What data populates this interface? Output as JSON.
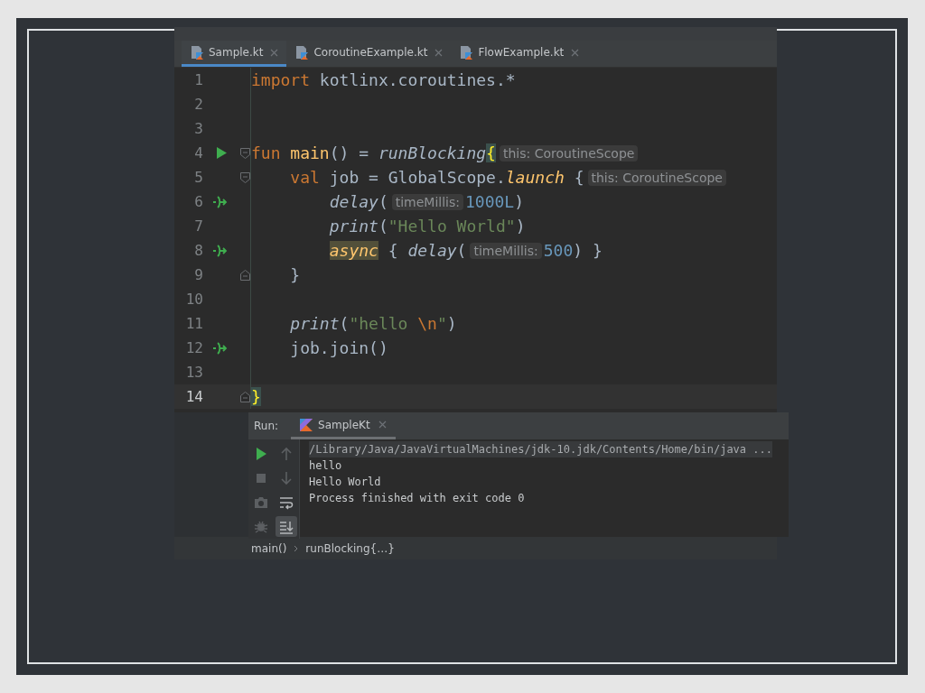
{
  "tabs": [
    {
      "label": "Sample.kt",
      "selected": true
    },
    {
      "label": "CoroutineExample.kt",
      "selected": false
    },
    {
      "label": "FlowExample.kt",
      "selected": false
    }
  ],
  "editor": {
    "lines": [
      {
        "number": "1",
        "current": false,
        "run_marker": false,
        "suspend_marker": false,
        "fold_start": false,
        "fold_end": false,
        "tokens": [
          {
            "t": "import",
            "kind": "keyword"
          },
          {
            "t": " kotlinx.coroutines.*",
            "kind": "plain"
          }
        ]
      },
      {
        "number": "2",
        "current": false,
        "run_marker": false,
        "suspend_marker": false,
        "fold_start": false,
        "fold_end": false
      },
      {
        "number": "3",
        "current": false,
        "run_marker": false,
        "suspend_marker": false,
        "fold_start": false,
        "fold_end": false
      },
      {
        "number": "4",
        "current": false,
        "run_marker": true,
        "suspend_marker": false,
        "fold_start": true,
        "fold_end": false,
        "tokens": [
          {
            "t": "fun",
            "kind": "keyword"
          },
          {
            "t": " main",
            "kind": "name"
          },
          {
            "t": "() = ",
            "kind": "plain"
          },
          {
            "t": "runBlocking",
            "kind": "call"
          },
          {
            "t": "{",
            "kind": "brace-match"
          },
          {
            "t": "this: CoroutineScope",
            "kind": "hint"
          }
        ]
      },
      {
        "number": "5",
        "current": false,
        "run_marker": false,
        "suspend_marker": false,
        "fold_start": true,
        "fold_end": false,
        "tokens": [
          {
            "t": "    val",
            "kind": "keyword"
          },
          {
            "t": " job = GlobalScope.",
            "kind": "plain"
          },
          {
            "t": "launch",
            "kind": "ext-call"
          },
          {
            "t": " {",
            "kind": "plain"
          },
          {
            "t": "this: CoroutineScope",
            "kind": "hint"
          }
        ]
      },
      {
        "number": "6",
        "current": false,
        "run_marker": false,
        "suspend_marker": true,
        "fold_start": false,
        "fold_end": false,
        "tokens": [
          {
            "t": "        delay",
            "kind": "call"
          },
          {
            "t": "(",
            "kind": "plain"
          },
          {
            "t": "timeMillis:",
            "kind": "hint"
          },
          {
            "t": "1000L",
            "kind": "number"
          },
          {
            "t": ")",
            "kind": "plain"
          }
        ]
      },
      {
        "number": "7",
        "current": false,
        "run_marker": false,
        "suspend_marker": false,
        "fold_start": false,
        "fold_end": false,
        "tokens": [
          {
            "t": "        print",
            "kind": "call"
          },
          {
            "t": "(",
            "kind": "plain"
          },
          {
            "t": "\"Hello World\"",
            "kind": "string"
          },
          {
            "t": ")",
            "kind": "plain"
          }
        ]
      },
      {
        "number": "8",
        "current": false,
        "run_marker": false,
        "suspend_marker": true,
        "fold_start": false,
        "fold_end": false,
        "tokens": [
          {
            "t": "        async",
            "kind": "async-highlight"
          },
          {
            "t": " { ",
            "kind": "plain"
          },
          {
            "t": "delay",
            "kind": "call"
          },
          {
            "t": "(",
            "kind": "plain"
          },
          {
            "t": "timeMillis:",
            "kind": "hint"
          },
          {
            "t": "500",
            "kind": "number"
          },
          {
            "t": ") }",
            "kind": "plain"
          }
        ]
      },
      {
        "number": "9",
        "current": false,
        "run_marker": false,
        "suspend_marker": false,
        "fold_start": false,
        "fold_end": true,
        "tokens": [
          {
            "t": "    }",
            "kind": "plain"
          }
        ]
      },
      {
        "number": "10",
        "current": false,
        "run_marker": false,
        "suspend_marker": false,
        "fold_start": false,
        "fold_end": false
      },
      {
        "number": "11",
        "current": false,
        "run_marker": false,
        "suspend_marker": false,
        "fold_start": false,
        "fold_end": false,
        "tokens": [
          {
            "t": "    print",
            "kind": "call"
          },
          {
            "t": "(",
            "kind": "plain"
          },
          {
            "t": "\"hello ",
            "kind": "string"
          },
          {
            "t": "\\n",
            "kind": "escape"
          },
          {
            "t": "\"",
            "kind": "string"
          },
          {
            "t": ")",
            "kind": "plain"
          }
        ]
      },
      {
        "number": "12",
        "current": false,
        "run_marker": false,
        "suspend_marker": true,
        "fold_start": false,
        "fold_end": false,
        "tokens": [
          {
            "t": "    job.join()",
            "kind": "plain"
          }
        ]
      },
      {
        "number": "13",
        "current": false,
        "run_marker": false,
        "suspend_marker": false,
        "fold_start": false,
        "fold_end": false
      },
      {
        "number": "14",
        "current": true,
        "run_marker": false,
        "suspend_marker": false,
        "fold_start": false,
        "fold_end": true,
        "tokens": [
          {
            "t": "}",
            "kind": "brace-match"
          }
        ]
      }
    ]
  },
  "run_panel": {
    "label": "Run:",
    "tab": "SampleKt",
    "tools": [
      {
        "kind": "run",
        "disabled": false,
        "selected": false
      },
      {
        "kind": "up",
        "disabled": true,
        "selected": false
      },
      {
        "kind": "stop",
        "disabled": true,
        "selected": false
      },
      {
        "kind": "down",
        "disabled": true,
        "selected": false
      },
      {
        "kind": "camera",
        "disabled": true,
        "selected": false
      },
      {
        "kind": "wrap",
        "disabled": false,
        "selected": false
      },
      {
        "kind": "bug",
        "disabled": true,
        "selected": false
      },
      {
        "kind": "scroll-end",
        "disabled": false,
        "selected": true
      }
    ],
    "output": [
      {
        "text": "/Library/Java/JavaVirtualMachines/jdk-10.jdk/Contents/Home/bin/java ...",
        "kind": "command"
      },
      {
        "text": "hello",
        "kind": "stdout"
      },
      {
        "text": "Hello World",
        "kind": "stdout"
      },
      {
        "text": "Process finished with exit code 0",
        "kind": "stdout"
      }
    ]
  },
  "breadcrumbs": [
    "main()",
    "runBlocking{…}"
  ]
}
